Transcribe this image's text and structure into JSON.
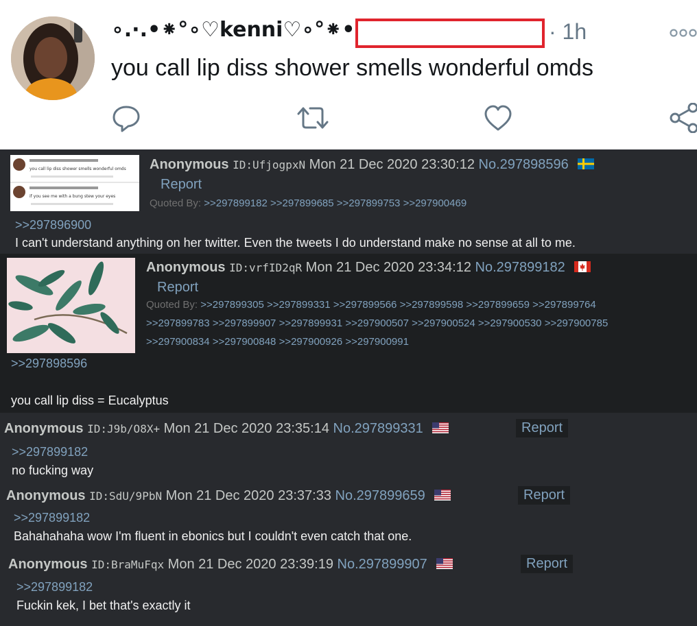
{
  "tweet": {
    "display_name": "∘.·.•⁕°∘♡kenni♡∘°⁕•.·.∘",
    "time": "· 1h",
    "text": "you call lip diss shower smells wonderful omds",
    "icons": [
      "reply-icon",
      "retweet-icon",
      "like-icon",
      "share-icon",
      "more-icon"
    ],
    "redaction_color": "#e0242d"
  },
  "posts": [
    {
      "name": "Anonymous",
      "id": "ID:UfjogpxN",
      "datetime": "Mon 21 Dec 2020 23:30:12",
      "number": "No.297898596",
      "flag": "sweden-flag",
      "report": "Report",
      "quoted_by_label": "Quoted By:",
      "quoted_by": [
        ">>297899182",
        ">>297899685",
        ">>297899753",
        ">>297900469"
      ],
      "quote": ">>297896900",
      "text": "I can't understand anything on her twitter. Even the tweets I do understand make no sense at all to me.",
      "thumb_lines": [
        "you call lip diss shower smells wonderful omds",
        "if you see me with a bung stew your eyes"
      ]
    },
    {
      "name": "Anonymous",
      "id": "ID:vrfID2qR",
      "datetime": "Mon 21 Dec 2020 23:34:12",
      "number": "No.297899182",
      "flag": "canada-flag",
      "report": "Report",
      "quoted_by_label": "Quoted By:",
      "quoted_by_lines": [
        [
          ">>297899305",
          ">>297899331",
          ">>297899566",
          ">>297899598",
          ">>297899659",
          ">>297899764"
        ],
        [
          ">>297899783",
          ">>297899907",
          ">>297899931",
          ">>297900507",
          ">>297900524",
          ">>297900530",
          ">>297900785"
        ],
        [
          ">>297900834",
          ">>297900848",
          ">>297900926",
          ">>297900991"
        ]
      ],
      "quote": ">>297898596",
      "text": "you call lip diss = Eucalyptus"
    },
    {
      "name": "Anonymous",
      "id": "ID:J9b/O8X+",
      "datetime": "Mon 21 Dec 2020 23:35:14",
      "number": "No.297899331",
      "flag": "usa-flag",
      "report": "Report",
      "quote": ">>297899182",
      "text": "no fucking way"
    },
    {
      "name": "Anonymous",
      "id": "ID:SdU/9PbN",
      "datetime": "Mon 21 Dec 2020 23:37:33",
      "number": "No.297899659",
      "flag": "usa-flag",
      "report": "Report",
      "quote": ">>297899182",
      "text": "Bahahahaha wow I'm fluent in ebonics but I couldn't even catch that one."
    },
    {
      "name": "Anonymous",
      "id": "ID:BraMuFqx",
      "datetime": "Mon 21 Dec 2020 23:39:19",
      "number": "No.297899907",
      "flag": "usa-flag",
      "report": "Report",
      "quote": ">>297899182",
      "text": "Fuckin kek, I bet that's exactly it"
    }
  ],
  "colors": {
    "post_bg": "#282a2e",
    "highlight_bg": "#1d1f21",
    "link": "#81a2be",
    "text": "#c5c8c6"
  }
}
